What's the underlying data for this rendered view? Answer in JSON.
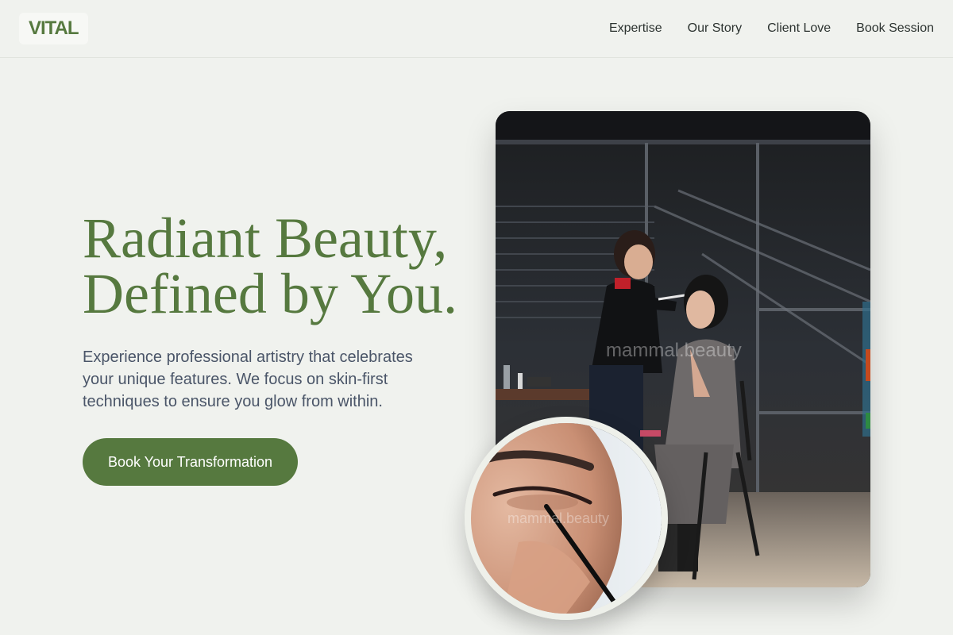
{
  "header": {
    "logo": "VITAL",
    "nav": [
      {
        "label": "Expertise"
      },
      {
        "label": "Our Story"
      },
      {
        "label": "Client Love"
      },
      {
        "label": "Book Session"
      }
    ]
  },
  "hero": {
    "title_line1": "Radiant Beauty,",
    "title_line2": "Defined by You.",
    "description": "Experience professional artistry that celebrates your unique features. We focus on skin-first techniques to ensure you glow from within.",
    "cta_label": "Book Your Transformation"
  },
  "images": {
    "main_watermark": "mammal.beauty",
    "inset_watermark": "mammal.beauty"
  },
  "colors": {
    "accent": "#56793f",
    "background": "#f0f2ee",
    "body_text": "#4a5568"
  }
}
